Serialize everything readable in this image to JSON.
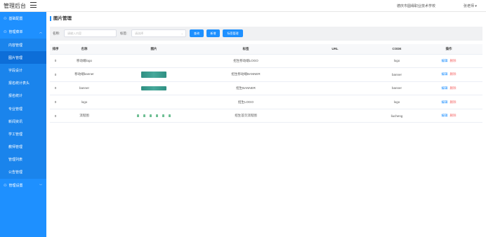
{
  "app": {
    "title": "管理后台",
    "school": "德庆市圆缘职业技术学校",
    "user": "张老师 ▾"
  },
  "sidebar": {
    "groups": [
      {
        "label": "基础配置"
      },
      {
        "label": "管理菜单"
      },
      {
        "label": "管理设置"
      }
    ],
    "items": [
      {
        "label": "内容管理"
      },
      {
        "label": "图片管理"
      },
      {
        "label": "字段设计"
      },
      {
        "label": "报名统计表头"
      },
      {
        "label": "报名统计"
      },
      {
        "label": "专业管理"
      },
      {
        "label": "新闻资讯"
      },
      {
        "label": "学工管理"
      },
      {
        "label": "教师管理"
      },
      {
        "label": "管理列表"
      },
      {
        "label": "公告管理"
      }
    ]
  },
  "main": {
    "title": "图片管理",
    "filter": {
      "name_label": "名称:",
      "name_placeholder": "请输入内容",
      "tag_label": "标签:",
      "tag_placeholder": "请选择",
      "btn_query": "查询",
      "btn_add": "新增",
      "btn_tag": "标签管理"
    },
    "table": {
      "headers": [
        "排序",
        "名称",
        "图片",
        "标签",
        "URL",
        "CODE",
        "操作"
      ],
      "rows": [
        {
          "sort": "0",
          "name": "移动端logo",
          "tag": "招生移动端LOGO",
          "url": "",
          "code": "logo"
        },
        {
          "sort": "0",
          "name": "移动端banner",
          "tag": "招生移动端BANNER",
          "url": "",
          "code": "banner"
        },
        {
          "sort": "0",
          "name": "banner",
          "tag": "招生BANNER",
          "url": "",
          "code": "banner"
        },
        {
          "sort": "0",
          "name": "logo",
          "tag": "招生LOGO",
          "url": "",
          "code": "logo"
        },
        {
          "sort": "0",
          "name": "流程图",
          "tag": "招生首页流程图",
          "url": "",
          "code": "liucheng"
        }
      ],
      "action_edit": "编辑",
      "action_delete": "删除"
    }
  },
  "colors": {
    "accent": "#1e90ff",
    "danger": "#f56c6c"
  },
  "icons": {
    "menu": "hamburger-icon",
    "group": "person-icon",
    "chevron": "chevron-down-icon",
    "select_caret": "chevron-down-icon"
  }
}
